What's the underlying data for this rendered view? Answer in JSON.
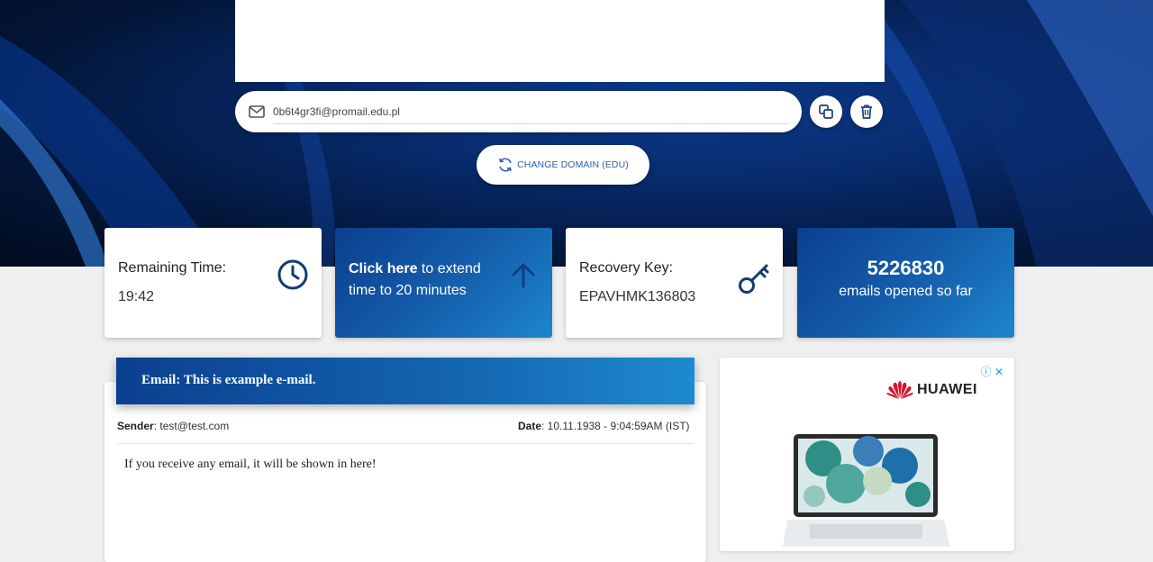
{
  "email": {
    "address": "0b6t4gr3fi@promail.edu.pl"
  },
  "actions": {
    "change_domain_label": "CHANGE DOMAIN (EDU)"
  },
  "stats": {
    "remaining_label": "Remaining Time:",
    "remaining_value": "19:42",
    "extend_bold": "Click here",
    "extend_rest": " to extend time to 20 minutes",
    "recovery_label": "Recovery Key:",
    "recovery_value": "EPAVHMK136803",
    "opened_count": "5226830",
    "opened_label": "emails opened so far"
  },
  "message": {
    "subject": "Email: This is example e-mail.",
    "sender_label": "Sender",
    "sender_value": ": test@test.com",
    "date_label": "Date",
    "date_value": ": 10.11.1938 - 9:04:59AM (IST)",
    "body": "If you receive any email, it will be shown in here!"
  },
  "ad": {
    "brand": "HUAWEI",
    "controls": "ⓘ ✕"
  },
  "colors": {
    "accent_blue": "#1560ad",
    "link_blue": "#2f5fb3",
    "icon_navy": "#123a73"
  },
  "icons": [
    "mail-icon",
    "copy-icon",
    "trash-icon",
    "refresh-icon",
    "clock-icon",
    "arrow-up-icon",
    "key-icon",
    "huawei-logo-icon"
  ]
}
